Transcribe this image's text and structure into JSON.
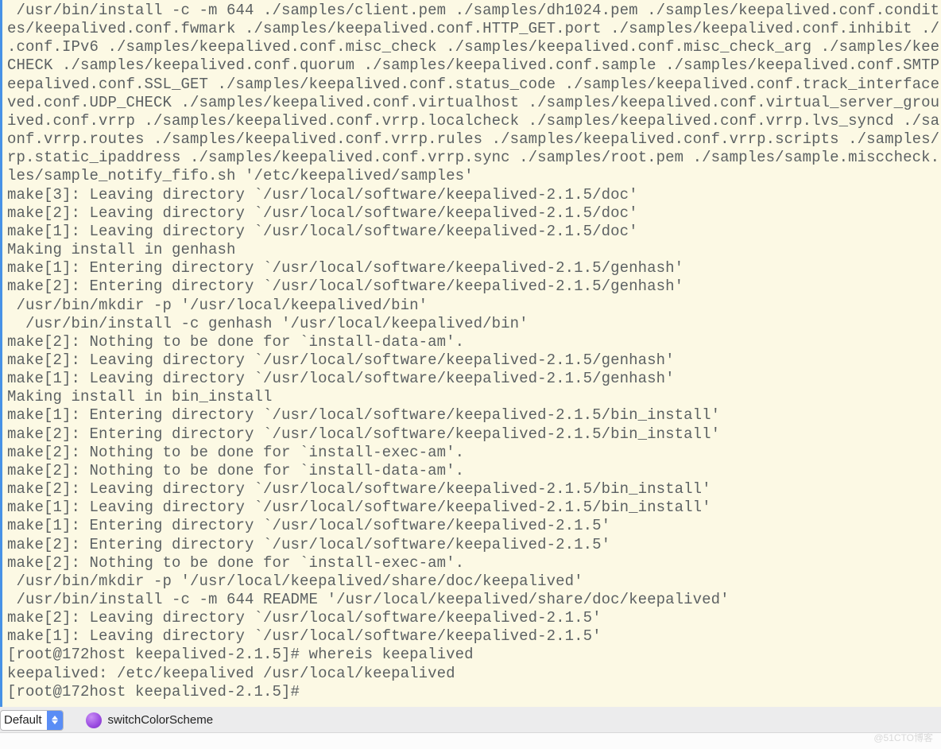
{
  "terminal": {
    "lines": [
      " /usr/bin/install -c -m 644 ./samples/client.pem ./samples/dh1024.pem ./samples/keepalived.conf.condit",
      "es/keepalived.conf.fwmark ./samples/keepalived.conf.HTTP_GET.port ./samples/keepalived.conf.inhibit ./",
      ".conf.IPv6 ./samples/keepalived.conf.misc_check ./samples/keepalived.conf.misc_check_arg ./samples/kee",
      "CHECK ./samples/keepalived.conf.quorum ./samples/keepalived.conf.sample ./samples/keepalived.conf.SMTP",
      "eepalived.conf.SSL_GET ./samples/keepalived.conf.status_code ./samples/keepalived.conf.track_interface",
      "ved.conf.UDP_CHECK ./samples/keepalived.conf.virtualhost ./samples/keepalived.conf.virtual_server_grou",
      "ived.conf.vrrp ./samples/keepalived.conf.vrrp.localcheck ./samples/keepalived.conf.vrrp.lvs_syncd ./sa",
      "onf.vrrp.routes ./samples/keepalived.conf.vrrp.rules ./samples/keepalived.conf.vrrp.scripts ./samples/",
      "rp.static_ipaddress ./samples/keepalived.conf.vrrp.sync ./samples/root.pem ./samples/sample.misccheck.",
      "les/sample_notify_fifo.sh '/etc/keepalived/samples'",
      "make[3]: Leaving directory `/usr/local/software/keepalived-2.1.5/doc'",
      "make[2]: Leaving directory `/usr/local/software/keepalived-2.1.5/doc'",
      "make[1]: Leaving directory `/usr/local/software/keepalived-2.1.5/doc'",
      "Making install in genhash",
      "make[1]: Entering directory `/usr/local/software/keepalived-2.1.5/genhash'",
      "make[2]: Entering directory `/usr/local/software/keepalived-2.1.5/genhash'",
      " /usr/bin/mkdir -p '/usr/local/keepalived/bin'",
      "  /usr/bin/install -c genhash '/usr/local/keepalived/bin'",
      "make[2]: Nothing to be done for `install-data-am'.",
      "make[2]: Leaving directory `/usr/local/software/keepalived-2.1.5/genhash'",
      "make[1]: Leaving directory `/usr/local/software/keepalived-2.1.5/genhash'",
      "Making install in bin_install",
      "make[1]: Entering directory `/usr/local/software/keepalived-2.1.5/bin_install'",
      "make[2]: Entering directory `/usr/local/software/keepalived-2.1.5/bin_install'",
      "make[2]: Nothing to be done for `install-exec-am'.",
      "make[2]: Nothing to be done for `install-data-am'.",
      "make[2]: Leaving directory `/usr/local/software/keepalived-2.1.5/bin_install'",
      "make[1]: Leaving directory `/usr/local/software/keepalived-2.1.5/bin_install'",
      "make[1]: Entering directory `/usr/local/software/keepalived-2.1.5'",
      "make[2]: Entering directory `/usr/local/software/keepalived-2.1.5'",
      "make[2]: Nothing to be done for `install-exec-am'.",
      " /usr/bin/mkdir -p '/usr/local/keepalived/share/doc/keepalived'",
      " /usr/bin/install -c -m 644 README '/usr/local/keepalived/share/doc/keepalived'",
      "make[2]: Leaving directory `/usr/local/software/keepalived-2.1.5'",
      "make[1]: Leaving directory `/usr/local/software/keepalived-2.1.5'",
      "[root@172host keepalived-2.1.5]# whereis keepalived",
      "keepalived: /etc/keepalived /usr/local/keepalived",
      "[root@172host keepalived-2.1.5]# "
    ]
  },
  "statusbar": {
    "select_value": "Default",
    "button_label": "switchColorScheme"
  },
  "watermark": "@51CTO博客"
}
